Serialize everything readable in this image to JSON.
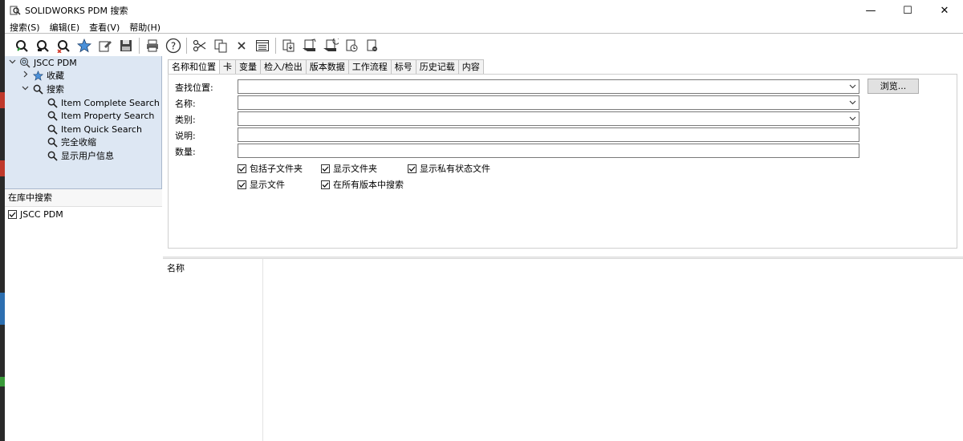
{
  "window": {
    "title": "SOLIDWORKS PDM 搜索",
    "controls": {
      "minimize": "—",
      "maximize": "☐",
      "close": "✕"
    }
  },
  "menu": [
    "搜索(S)",
    "编辑(E)",
    "查看(V)",
    "帮助(H)"
  ],
  "toolbar": {
    "icons": [
      "search-green-icon",
      "search-black-icon",
      "search-red-icon",
      "favorite-star-icon",
      "edit-card-icon",
      "save-icon",
      "print-icon",
      "help-icon",
      "cut-icon",
      "copy-icon",
      "delete-icon",
      "properties-icon",
      "checkout-icon",
      "checkin-icon",
      "undo-checkout-icon",
      "get-latest-icon",
      "file-history-icon"
    ]
  },
  "tree": {
    "root": "JSCC PDM",
    "favorites": "收藏",
    "search": "搜索",
    "items": [
      "Item Complete Search",
      "Item Property Search",
      "Item Quick Search",
      "完全收缩",
      "显示用户信息"
    ]
  },
  "vault_panel": {
    "heading": "在库中搜索",
    "vault": "JSCC PDM",
    "vault_checked": true
  },
  "tabs": [
    "名称和位置",
    "卡",
    "变量",
    "检入/检出",
    "版本数据",
    "工作流程",
    "标号",
    "历史记载",
    "内容"
  ],
  "form": {
    "look_in_label": "查找位置:",
    "name_label": "名称:",
    "category_label": "类别:",
    "description_label": "说明:",
    "quantity_label": "数量:",
    "browse_label": "浏览...",
    "look_in_value": "",
    "name_value": "",
    "category_value": "",
    "description_value": "",
    "quantity_value": ""
  },
  "options": {
    "include_subfolders": {
      "label": "包括子文件夹",
      "checked": true
    },
    "show_folders": {
      "label": "显示文件夹",
      "checked": true
    },
    "show_private_state_files": {
      "label": "显示私有状态文件",
      "checked": true
    },
    "show_files": {
      "label": "显示文件",
      "checked": true
    },
    "search_all_versions": {
      "label": "在所有版本中搜索",
      "checked": true
    }
  },
  "results": {
    "columns": [
      "名称"
    ]
  }
}
